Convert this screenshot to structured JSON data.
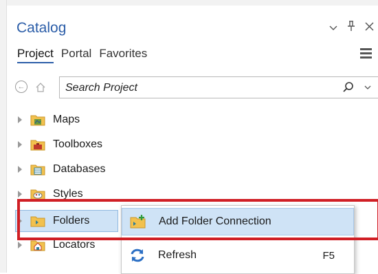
{
  "pane": {
    "title": "Catalog",
    "controls": {
      "dropdown": "⌄",
      "pin": "ꟸ",
      "close": "✕"
    }
  },
  "tabs": [
    {
      "label": "Project",
      "active": true
    },
    {
      "label": "Portal",
      "active": false
    },
    {
      "label": "Favorites",
      "active": false
    }
  ],
  "search": {
    "placeholder": "Search Project"
  },
  "tree": [
    {
      "label": "Maps",
      "icon": "maps-folder-icon"
    },
    {
      "label": "Toolboxes",
      "icon": "toolboxes-folder-icon"
    },
    {
      "label": "Databases",
      "icon": "databases-folder-icon"
    },
    {
      "label": "Styles",
      "icon": "styles-folder-icon"
    },
    {
      "label": "Folders",
      "icon": "folders-folder-icon",
      "selected": true
    },
    {
      "label": "Locators",
      "icon": "locators-folder-icon"
    }
  ],
  "context_menu": {
    "items": [
      {
        "label": "Add Folder Connection",
        "icon": "add-folder-connection-icon",
        "shortcut": ""
      },
      {
        "label": "Refresh",
        "icon": "refresh-icon",
        "shortcut": "F5"
      }
    ]
  },
  "colors": {
    "accent": "#2b5da8",
    "selection": "#cfe3f6",
    "highlight_box": "#d01f25",
    "folder_yellow": "#f2c14e"
  }
}
